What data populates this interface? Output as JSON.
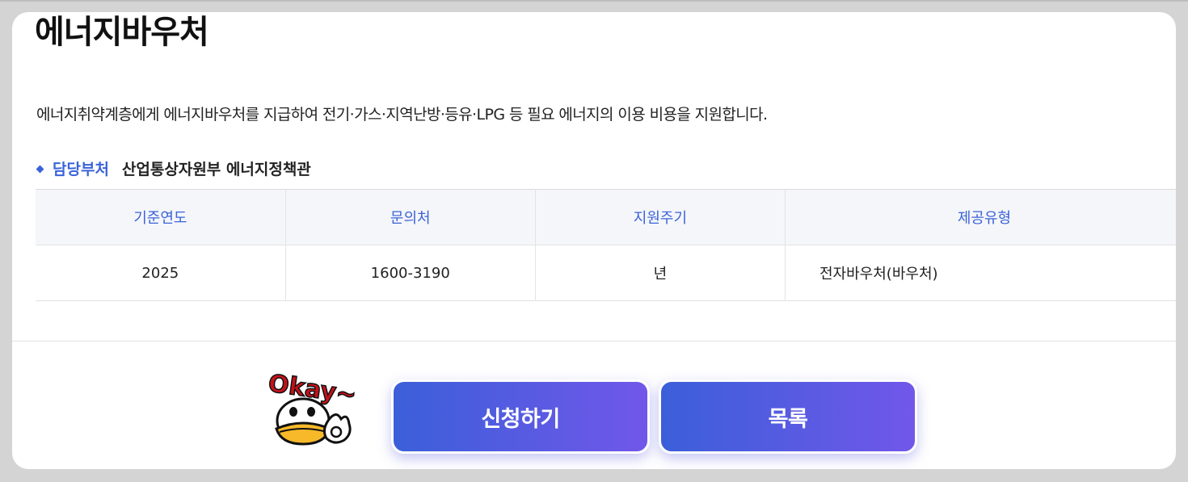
{
  "page": {
    "title": "에너지바우처",
    "description": "에너지취약계층에게 에너지바우처를 지급하여 전기·가스·지역난방·등유·LPG 등 필요 에너지의 이용 비용을 지원합니다."
  },
  "department": {
    "label": "담당부처",
    "value": "산업통상자원부 에너지정책관"
  },
  "table": {
    "headers": [
      "기준연도",
      "문의처",
      "지원주기",
      "제공유형"
    ],
    "row": [
      "2025",
      "1600-3190",
      "년",
      "전자바우처(바우처)"
    ]
  },
  "mascot": {
    "icon": "okay-duck-mascot-icon",
    "text": "Okay~"
  },
  "buttons": {
    "apply_label": "신청하기",
    "list_label": "목록"
  },
  "colors": {
    "accent": "#3a63d8",
    "button_gradient_start": "#3b5fd9",
    "button_gradient_end": "#7157ea"
  }
}
